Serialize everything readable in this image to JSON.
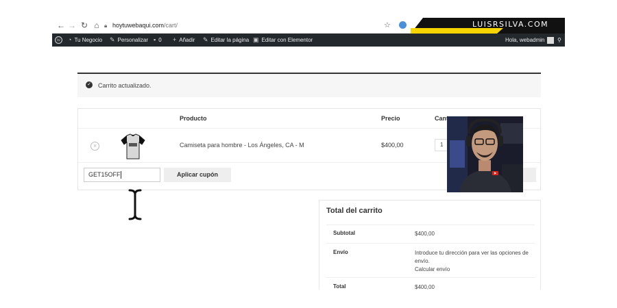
{
  "browser": {
    "url_host": "hoytuwebaqui.com",
    "url_path": "/cart/",
    "brand_text": "LUISRSILVA.COM"
  },
  "admin_bar": {
    "items": [
      "Tu Negocio",
      "Personalizar",
      "0",
      "Añadir",
      "Editar la página",
      "Editar con Elementor"
    ],
    "greeting": "Hola, webadmin"
  },
  "notice": {
    "message": "Carrito actualizado."
  },
  "cart": {
    "headers": {
      "product": "Producto",
      "price": "Precio",
      "quantity": "Cant"
    },
    "items": [
      {
        "name": "Camiseta para hombre - Los Ángeles, CA - M",
        "price": "$400,00",
        "quantity": "1"
      }
    ],
    "coupon_value": "GET15OFF",
    "apply_label": "Aplicar cupón"
  },
  "totals": {
    "title": "Total del carrito",
    "subtotal_label": "Subtotal",
    "subtotal_value": "$400,00",
    "shipping_label": "Envío",
    "shipping_text": "Introduce tu dirección para ver las opciones de envío.",
    "shipping_link": "Calcular envío",
    "total_label": "Total",
    "total_value": "$400,00"
  },
  "colors": {
    "admin_bar": "#23282d",
    "brand_yellow": "#f5d400"
  }
}
